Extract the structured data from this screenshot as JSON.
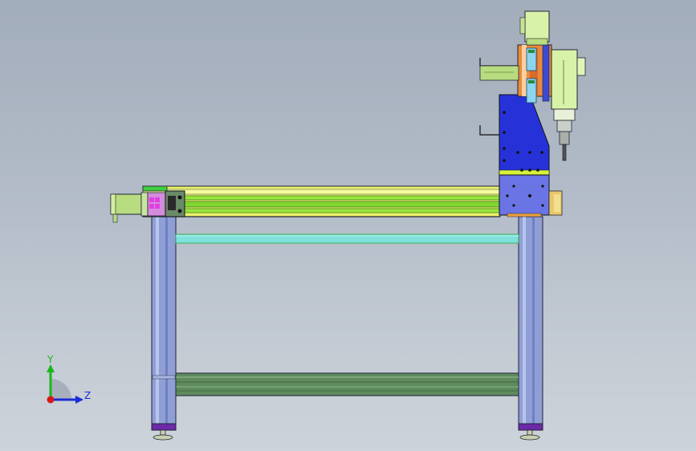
{
  "viewport": {
    "background_top": "#a2adbb",
    "background_bottom": "#cdd3da"
  },
  "triad": {
    "y_label": "Y",
    "z_label": "Z",
    "y_color": "#18b818",
    "z_color": "#1a2cd8",
    "x_color": "#d81818"
  },
  "model": {
    "description_icon": "cnc-router-side-view",
    "colors": {
      "leg": "#8f9fd6",
      "leg_foot": "#6c2aa8",
      "rail_green": "#9ae63c",
      "rail_yellow": "#e8f26a",
      "gantry_blue": "#2632d8",
      "spindle_green": "#d8f2a8",
      "crossbar_cyan": "#7fe0dc",
      "lower_beam": "#5e8a5e"
    }
  }
}
